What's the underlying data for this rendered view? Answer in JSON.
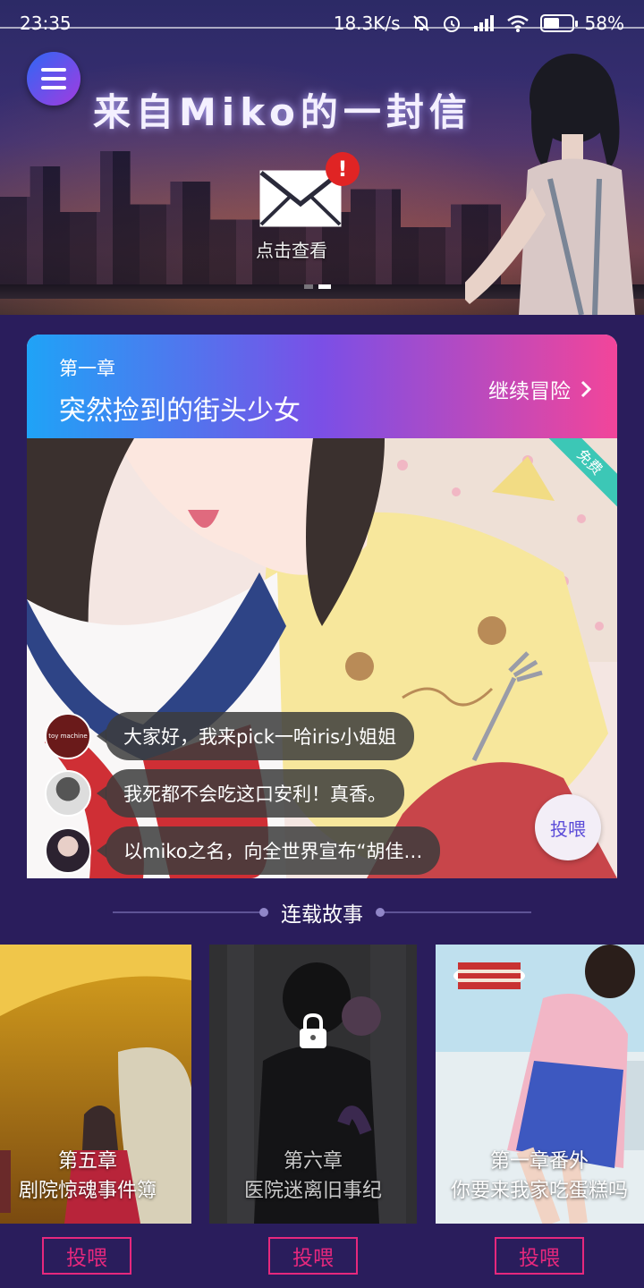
{
  "status_bar": {
    "time": "23:35",
    "speed": "18.3K/s",
    "battery_level": 0.58,
    "battery_text": "58%",
    "icons": [
      "bell-muted-icon",
      "alarm-icon",
      "hd-signal-icon",
      "wifi-icon",
      "battery-icon"
    ]
  },
  "banner": {
    "title": "来自Miko的一封信",
    "mail_badge": "!",
    "mail_label": "点击查看"
  },
  "chapter_card": {
    "chapter_num": "第一章",
    "title": "突然捡到的街头少女",
    "continue_label": "继续冒险",
    "free_badge": "免费",
    "comments": [
      {
        "text": "大家好，我来pick一哈iris小姐姐"
      },
      {
        "text": "我死都不会吃这口安利！真香。"
      },
      {
        "text": "以miko之名，向全世界宣布“胡佳…"
      }
    ],
    "avatar_1_text": "toy machine",
    "feed_label": "投喂"
  },
  "section": {
    "title": "连载故事"
  },
  "stories": [
    {
      "chapter": "第五章",
      "title": "剧院惊魂事件簿",
      "locked": false,
      "feed_label": "投喂"
    },
    {
      "chapter": "第六章",
      "title": "医院迷离旧事纪",
      "locked": true,
      "feed_label": "投喂"
    },
    {
      "chapter": "第一章番外",
      "title": "你要来我家吃蛋糕吗",
      "locked": false,
      "feed_label": "投喂"
    }
  ],
  "colors": {
    "background": "#2a1d5c",
    "accent_pink": "#e6287d",
    "card_gradient_start": "#1fa3f7",
    "card_gradient_end": "#f2459a",
    "free_ribbon": "#3cc7b6"
  }
}
